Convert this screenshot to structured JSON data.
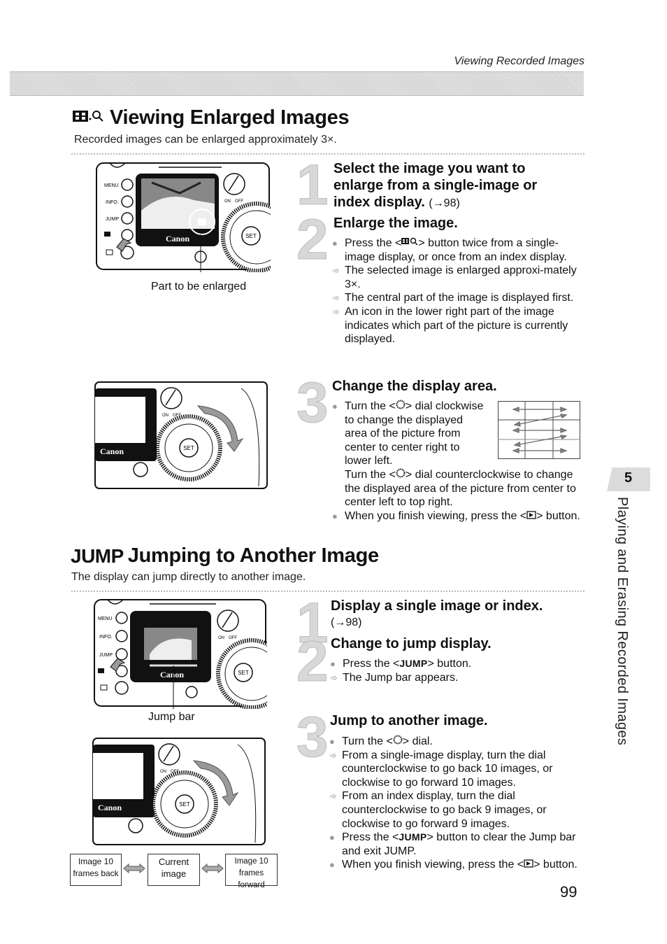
{
  "running_header": "Viewing Recorded Images",
  "section1": {
    "icon": "index-magnify-icon",
    "title": "Viewing Enlarged Images",
    "intro": "Recorded images can be enlarged approximately 3×.",
    "figure1_caption": "Part to be enlarged",
    "camera_labels": {
      "menu": "MENU",
      "info": "INFO.",
      "jump": "JUMP",
      "brand": "Canon",
      "set": "SET",
      "on": "ON",
      "off": "OFF"
    },
    "steps": [
      {
        "number": "1",
        "heading": "Select the image you want to enlarge from a single-image or index display.",
        "ref": "(→98)"
      },
      {
        "number": "2",
        "heading": "Enlarge the image.",
        "items": [
          {
            "marker": "bullet",
            "text_before": "Press the <",
            "icon": "index-magnify-icon",
            "text_after": "> button twice from a single-image display, or once from an index display."
          },
          {
            "marker": "arrow",
            "text": "The selected image is enlarged approxi-mately 3×."
          },
          {
            "marker": "arrow",
            "text": "The central part of the image is displayed first."
          },
          {
            "marker": "arrow",
            "text": "An icon in the lower right part of the image indicates which part of the picture is currently displayed."
          }
        ]
      },
      {
        "number": "3",
        "heading": "Change the display area.",
        "items": [
          {
            "marker": "bullet",
            "text_before": "Turn the <",
            "icon": "dial-icon",
            "text_after": "> dial clockwise to change the displayed area of the picture from center to center right to lower left."
          },
          {
            "marker": "none",
            "text_before": "Turn the <",
            "icon": "dial-icon",
            "text_after": "> dial counterclockwise to change the displayed area of the picture from center to center left to top right."
          },
          {
            "marker": "bullet",
            "text_before": "When you finish viewing, press the <",
            "icon": "playback-icon",
            "text_after": "> button."
          }
        ]
      }
    ]
  },
  "section2": {
    "icon_label": "JUMP",
    "title": "Jumping to Another Image",
    "intro": "The display can jump directly to another image.",
    "figure1_caption": "Jump bar",
    "jump_diagram": [
      {
        "line1": "Image 10",
        "line2": "frames back"
      },
      {
        "line1": "Current",
        "line2": "image"
      },
      {
        "line1": "Image 10",
        "line2": "frames forward"
      }
    ],
    "steps": [
      {
        "number": "1",
        "heading": "Display a single image or index.",
        "ref": "(→98)"
      },
      {
        "number": "2",
        "heading": "Change to jump display.",
        "items": [
          {
            "marker": "bullet",
            "text_before": "Press the <",
            "code": "JUMP",
            "text_after": "> button."
          },
          {
            "marker": "arrow",
            "text": "The Jump bar appears."
          }
        ]
      },
      {
        "number": "3",
        "heading": "Jump to another image.",
        "items": [
          {
            "marker": "bullet",
            "text_before": "Turn the <",
            "icon": "dial-icon",
            "text_after": "> dial."
          },
          {
            "marker": "arrow",
            "text": "From a single-image display, turn the dial counterclockwise to go back 10 images, or clockwise to go forward 10 images."
          },
          {
            "marker": "arrow",
            "text": "From an index display, turn the dial counterclockwise to go back 9 images, or clockwise to go forward 9 images."
          },
          {
            "marker": "bullet",
            "text_before": "Press the <",
            "code": "JUMP",
            "text_after": "> button to clear the Jump bar and exit JUMP."
          },
          {
            "marker": "bullet",
            "text_before": "When you finish viewing, press the <",
            "icon": "playback-icon",
            "text_after": "> button."
          }
        ]
      }
    ]
  },
  "side_tab": {
    "chapter_number": "5",
    "chapter_title": "Playing and Erasing Recorded Images"
  },
  "page_number": "99"
}
